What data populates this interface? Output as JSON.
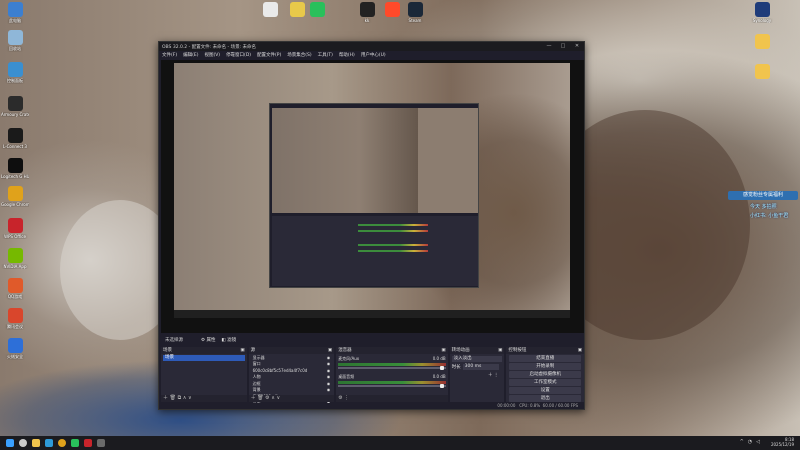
{
  "desktop": {
    "left_icons": [
      {
        "label": "此电脑",
        "color": "#3c7fd0",
        "icon": "computer-icon"
      },
      {
        "label": "回收站",
        "color": "#8fb7d8",
        "icon": "recycle-bin-icon"
      },
      {
        "label": "控制面板",
        "color": "#3a8fd0",
        "icon": "control-panel-icon"
      },
      {
        "label": "Armoury Crate",
        "color": "#2b2b2b",
        "icon": "armoury-icon"
      },
      {
        "label": "L-Connect 3",
        "color": "#1a1a1a",
        "icon": "lconnect-icon"
      },
      {
        "label": "Logitech G HUB",
        "color": "#0e0e0e",
        "icon": "ghub-icon"
      },
      {
        "label": "Google Chrome",
        "color": "#e0a21b",
        "icon": "chrome-icon"
      },
      {
        "label": "WPS Office",
        "color": "#c8242b",
        "icon": "wps-icon"
      },
      {
        "label": "NVIDIA App",
        "color": "#76b900",
        "icon": "nvidia-icon"
      },
      {
        "label": "QQ游戏",
        "color": "#e05a2a",
        "icon": "qq-game-icon"
      },
      {
        "label": "腾讯会议",
        "color": "#d9462c",
        "icon": "meeting-icon"
      },
      {
        "label": "火绒安全",
        "color": "#2d6fd8",
        "icon": "security-icon"
      }
    ],
    "top_icons": [
      {
        "label": "",
        "color": "#eaeaea",
        "icon": "file-icon"
      },
      {
        "label": "",
        "color": "#e8c94a",
        "icon": "app-icon"
      },
      {
        "label": "",
        "color": "#29c05b",
        "icon": "wechat-icon"
      },
      {
        "label": "kk",
        "color": "#222222",
        "icon": "kk-icon"
      },
      {
        "label": "",
        "color": "#ff4a2a",
        "icon": "app-icon"
      },
      {
        "label": "Steam",
        "color": "#1b2838",
        "icon": "steam-icon"
      }
    ],
    "right_icons": [
      {
        "label": "Synology",
        "color": "#1f3c7a",
        "icon": "nas-icon"
      },
      {
        "label": "",
        "color": "#f1c44d",
        "icon": "folder-icon"
      },
      {
        "label": "",
        "color": "#f1c44d",
        "icon": "folder-icon"
      }
    ],
    "banner": "感觉粉丝专属福利",
    "overlay_lines": [
      "今天 多拍照",
      "小红书: 小鱼干君"
    ]
  },
  "obs": {
    "title": "OBS 32.0.2 - 配置文件: 未命名 - 场景: 未命名",
    "menu": [
      "文件(F)",
      "编辑(E)",
      "视图(V)",
      "停靠窗口(D)",
      "配置文件(P)",
      "场景集合(S)",
      "工具(T)",
      "帮助(H)",
      "用户中心(U)"
    ],
    "scene_bar": {
      "current": "未选择源",
      "properties": "属性",
      "filters": "滤镜"
    },
    "docks": {
      "scenes": {
        "title": "场景",
        "items": [
          "场景"
        ]
      },
      "sources": {
        "title": "源",
        "items": [
          "显示器",
          "窗口",
          "600c0c8bf5c57ed4a4f7c0d",
          "人物",
          "边框",
          "背景",
          "表情8686.gif",
          "音乐"
        ]
      },
      "mixer": {
        "title": "混音器",
        "channels": [
          {
            "name": "麦克风/Aux",
            "db": "0.0 dB"
          },
          {
            "name": "桌面音频",
            "db": "0.0 dB"
          }
        ]
      },
      "transitions": {
        "title": "转场动画",
        "type": "淡入淡出",
        "duration_label": "时长",
        "duration": "300 ms"
      },
      "controls": {
        "title": "控制按钮",
        "buttons": [
          "结束直播",
          "开始录制",
          "启动虚拟摄像机",
          "工作室模式",
          "设置",
          "退出"
        ]
      }
    },
    "status": {
      "time": "00:00:00",
      "cpu": "CPU: 0.8%",
      "fps": "60.00 / 60.00 FPS"
    }
  },
  "taskbar": {
    "time": "8:18",
    "date": "2025/12/19"
  }
}
